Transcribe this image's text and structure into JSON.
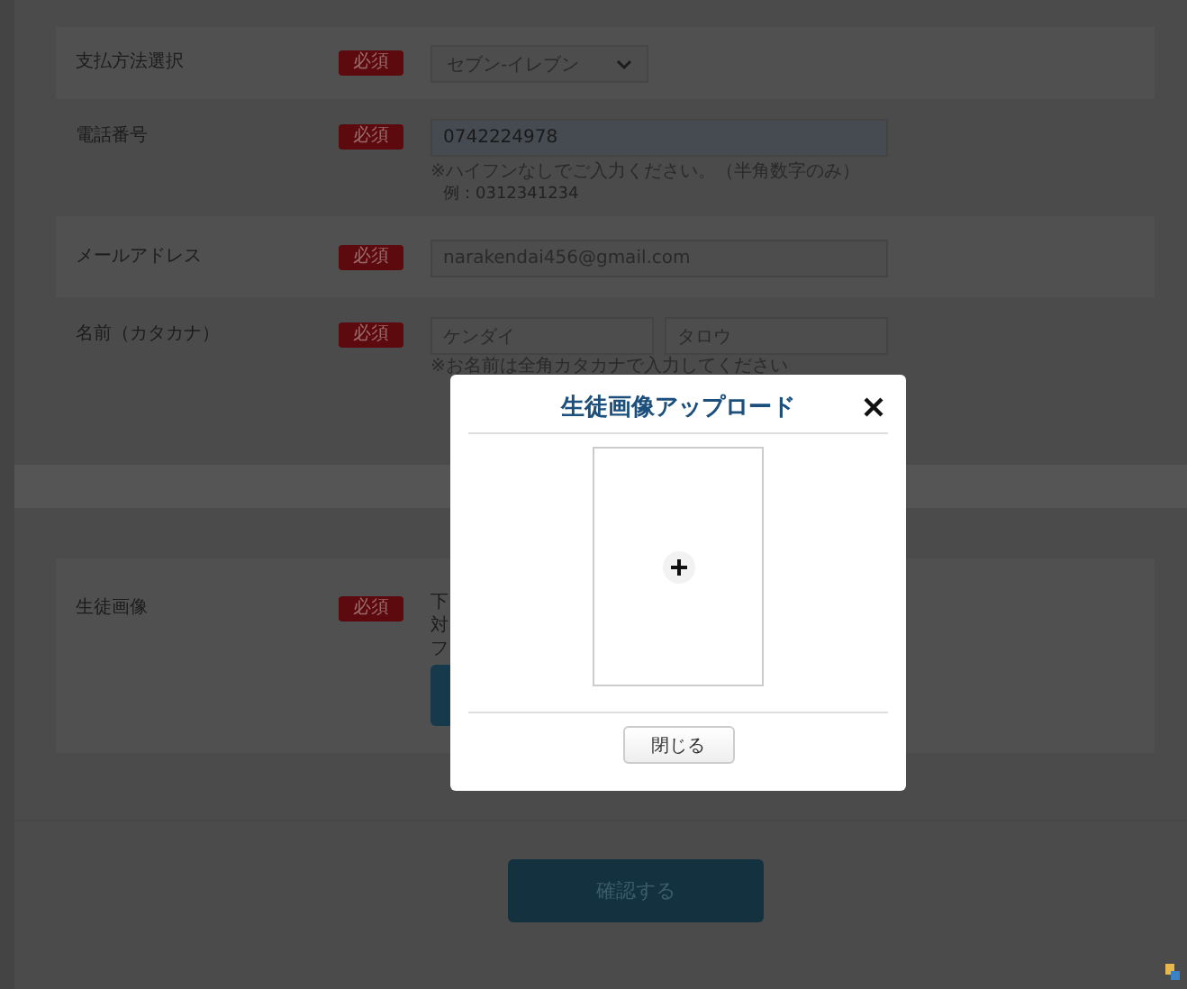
{
  "form": {
    "rows": [
      {
        "kind": "select",
        "label": "支払方法選択",
        "badge": "必須",
        "value": "セブン-イレブン"
      },
      {
        "kind": "text",
        "label": "電話番号",
        "badge": "必須",
        "value": "0742224978",
        "autofilled": true,
        "notes": [
          "※ハイフンなしでご入力ください。（半角数字のみ）"
        ],
        "example": "例：0312341234"
      },
      {
        "kind": "text",
        "label": "メールアドレス",
        "badge": "必須",
        "value": "narakendai456@gmail.com",
        "autofilled": false
      },
      {
        "kind": "name",
        "label": "名前（カタカナ）",
        "badge": "必須",
        "values": [
          "ケンダイ",
          "タロウ"
        ],
        "notes": [
          "※お名前は全角カタカナで入力してください"
        ]
      }
    ],
    "image_row": {
      "label": "生徒画像",
      "badge": "必須",
      "notes": [
        "下",
        "対",
        "フ"
      ]
    },
    "submit_button": "確認する"
  },
  "modal": {
    "title": "生徒画像アップロード",
    "close_button": "閉じる"
  }
}
